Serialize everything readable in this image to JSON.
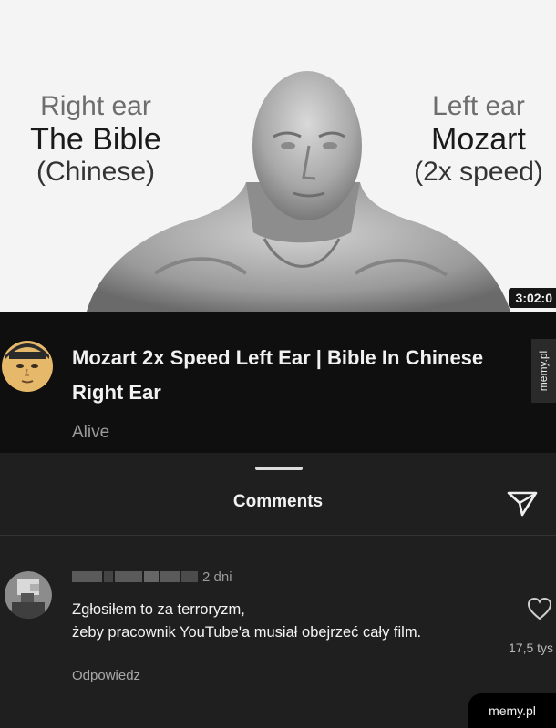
{
  "thumbnail": {
    "left_text": {
      "line1": "Right ear",
      "line2": "The Bible",
      "line3": "(Chinese)"
    },
    "right_text": {
      "line1": "Left ear",
      "line2": "Mozart",
      "line3": "(2x speed)"
    },
    "timestamp": "3:02:0",
    "figure_icon": "muscular-statue-figure"
  },
  "video": {
    "title": "Mozart 2x Speed Left Ear | Bible In Chinese Right Ear",
    "channel": "Alive"
  },
  "watermark_side": "memy.pl",
  "comments_sheet": {
    "title": "Comments",
    "send_icon": "send-icon",
    "comment": {
      "time": "2 dni",
      "text_line1": "Zgłosiłem to za terroryzm,",
      "text_line2": "żeby pracownik YouTube'a musiał obejrzeć cały film.",
      "like_count": "17,5 tys",
      "reply_label": "Odpowiedz"
    }
  },
  "watermark_bottom": "memy.pl",
  "colors": {
    "thumbnail_bg": "#f4f4f4",
    "video_info_bg": "#0f0f0f",
    "sheet_bg": "#1f1f1f",
    "text_primary": "#f1f1f1",
    "text_secondary": "#9a9a9a"
  }
}
